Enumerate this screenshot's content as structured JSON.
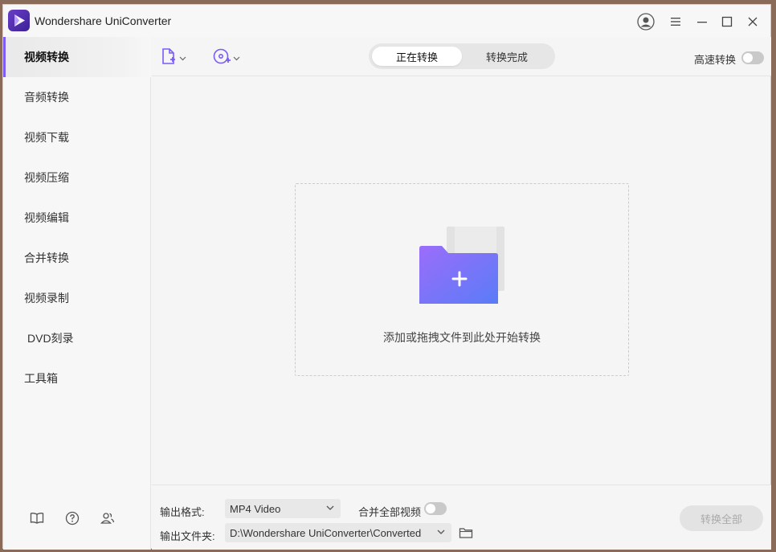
{
  "window": {
    "title": "Wondershare UniConverter"
  },
  "sidebar": {
    "items": [
      {
        "label": "视频转换",
        "active": true
      },
      {
        "label": "音频转换"
      },
      {
        "label": "视频下载"
      },
      {
        "label": "视频压缩"
      },
      {
        "label": "视频编辑"
      },
      {
        "label": "合并转换"
      },
      {
        "label": "视频录制"
      },
      {
        "label": "DVD刻录"
      },
      {
        "label": "工具箱"
      }
    ],
    "bottom_icons": [
      "book-icon",
      "help-icon",
      "users-icon"
    ]
  },
  "toolbar": {
    "add_file_icon": "add-file-icon",
    "add_dvd_icon": "add-dvd-icon",
    "tabs": [
      {
        "label": "正在转换",
        "active": true
      },
      {
        "label": "转换完成"
      }
    ],
    "speed_label": "高速转换",
    "speed_on": false
  },
  "dropzone": {
    "text": "添加或拖拽文件到此处开始转换"
  },
  "bottom": {
    "format_label": "输出格式:",
    "format_value": "MP4 Video",
    "merge_label": "合并全部视频",
    "merge_on": false,
    "folder_label": "输出文件夹:",
    "folder_value": "D:\\Wondershare UniConverter\\Converted",
    "convert_all": "转换全部"
  },
  "colors": {
    "accent": "#7b5cf5",
    "folder_start": "#9b6dfa",
    "folder_end": "#5a7cf7"
  }
}
